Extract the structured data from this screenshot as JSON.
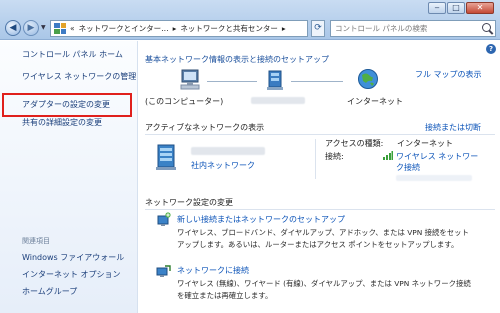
{
  "window": {
    "minimize": "‒",
    "maximize": "□",
    "close": "✕"
  },
  "nav": {
    "back_glyph": "◀",
    "forward_glyph": "▶",
    "refresh_glyph": "⟳"
  },
  "address": {
    "prefix": "«",
    "crumb1": "ネットワークとインター…",
    "sep1": "▸",
    "crumb2": "ネットワークと共有センター",
    "sep2": "▸"
  },
  "search": {
    "placeholder": "コントロール パネルの検索"
  },
  "sidebar": {
    "home": "コントロール パネル ホーム",
    "wireless": "ワイヤレス ネットワークの管理",
    "adapter": "アダプターの設定の変更",
    "advanced": "共有の詳細設定の変更",
    "related_caption": "関連項目",
    "related": [
      "Windows ファイアウォール",
      "インターネット オプション",
      "ホームグループ"
    ]
  },
  "main": {
    "help": "?",
    "basic_title": "基本ネットワーク情報の表示と接続のセットアップ",
    "full_map": "フル マップの表示",
    "this_computer": "(このコンピューター)",
    "internet": "インターネット",
    "active_title": "アクティブなネットワークの表示",
    "connect_or_disconnect": "接続または切断",
    "network_type": "社内ネットワーク",
    "access_type_label": "アクセスの種類:",
    "access_type_value": "インターネット",
    "connections_label": "接続:",
    "connections_value_line1": "ワイヤレス ネットワー",
    "connections_value_line2": "ク接続",
    "change_title": "ネットワーク設定の変更",
    "tasks": [
      {
        "title": "新しい接続またはネットワークのセットアップ",
        "desc_line1": "ワイヤレス、ブロードバンド、ダイヤルアップ、アドホック、または VPN 接続をセット",
        "desc_line2": "アップします。あるいは、ルーターまたはアクセス ポイントをセットアップします。"
      },
      {
        "title": "ネットワークに接続",
        "desc_line1": "ワイヤレス (無線)、ワイヤード (有線)、ダイヤルアップ、または VPN ネットワーク接続",
        "desc_line2": "を確立または再確立します。"
      }
    ]
  }
}
